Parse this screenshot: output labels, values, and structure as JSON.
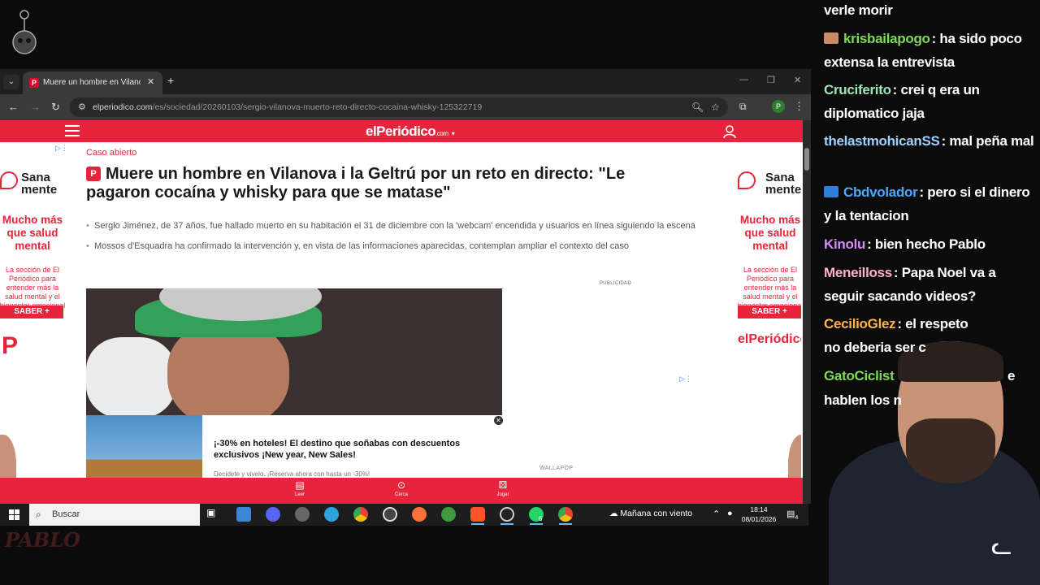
{
  "browser": {
    "tab_title": "Muere un hombre en Vilanova i",
    "url_host": "elperiodico.com",
    "url_path": "/es/sociedad/20260103/sergio-vilanova-muerto-reto-directo-cocaina-whisky-125322719",
    "profile_letter": "P"
  },
  "site": {
    "logo": "elPeriódico",
    "logo_suffix": ".com"
  },
  "side_ad": {
    "brand_line1": "Sana",
    "brand_line2": "mente",
    "headline": "Mucho más que salud mental",
    "body": "La sección de El Periódico para entender más la salud mental y el bienestar emocional",
    "button": "SABER +",
    "logo": "elPeriódico",
    "logo_short": "P"
  },
  "article": {
    "kicker": "Caso abierto",
    "headline": "Muere un hombre en Vilanova i la Geltrú por un reto en directo: \"Le pagaron cocaína y whisky para que se matase\"",
    "bullets": [
      "Sergio Jiménez, de 37 años, fue hallado muerto en su habitación el 31 de diciembre con la 'webcam' encendida y usuarios en línea siguiendo la escena",
      "Mossos d'Esquadra ha confirmado la intervención y, en vista de las informaciones aparecidas, contemplan ampliar el contexto del caso"
    ],
    "publicidad": "PUBLICIDAD",
    "promo_title": "¡-30% en hoteles! El destino que soñabas con descuentos exclusivos ¡New year, New Sales!",
    "promo_sub": "Decídete y vívelo. ¡Reserva ahora con hasta un -30%!",
    "promo_sponsor": "WALLAPOP"
  },
  "bottom_nav": [
    {
      "label": "Leer",
      "icon": "book-icon"
    },
    {
      "label": "Cerca",
      "icon": "location-pin-icon"
    },
    {
      "label": "Jugar",
      "icon": "dice-icon"
    }
  ],
  "taskbar": {
    "search_placeholder": "Buscar",
    "weather": "Mañana con viento",
    "time": "18:14",
    "date": "08/01/2026",
    "whatsapp_badge": "6",
    "notif_badge": "4"
  },
  "chat": [
    {
      "user": "",
      "msg": "verle morir",
      "color": "#ffffff"
    },
    {
      "user": "krisbailapogo",
      "msg": ": ha sido poco extensa la entrevista",
      "color": "#7ed957",
      "badge": "#c98a6a"
    },
    {
      "user": "Cruciferito",
      "msg": ": crei q era un diplomatico jaja",
      "color": "#9ee6b8"
    },
    {
      "user": "thelastmohicanSS",
      "msg": ": mal peña mal",
      "color": "#9fd3ff"
    },
    {
      "user": "Cbdvolador",
      "msg": ": pero si el dinero y la tentacion",
      "color": "#4aa8ff",
      "badge": "#2f7ed8"
    },
    {
      "user": "Kinolu",
      "msg": ": bien hecho Pablo",
      "color": "#d88cff"
    },
    {
      "user": "Meneilloss",
      "msg": ": Papa Noel va a seguir sacando videos?",
      "color": "#ffb3c7"
    },
    {
      "user": "CecilioGlez",
      "msg": ": el respeto no deberia ser c",
      "color": "#ffb347"
    },
    {
      "user": "GatoCiclist",
      "msg": "e hablen los n",
      "color": "#7ed957"
    }
  ]
}
